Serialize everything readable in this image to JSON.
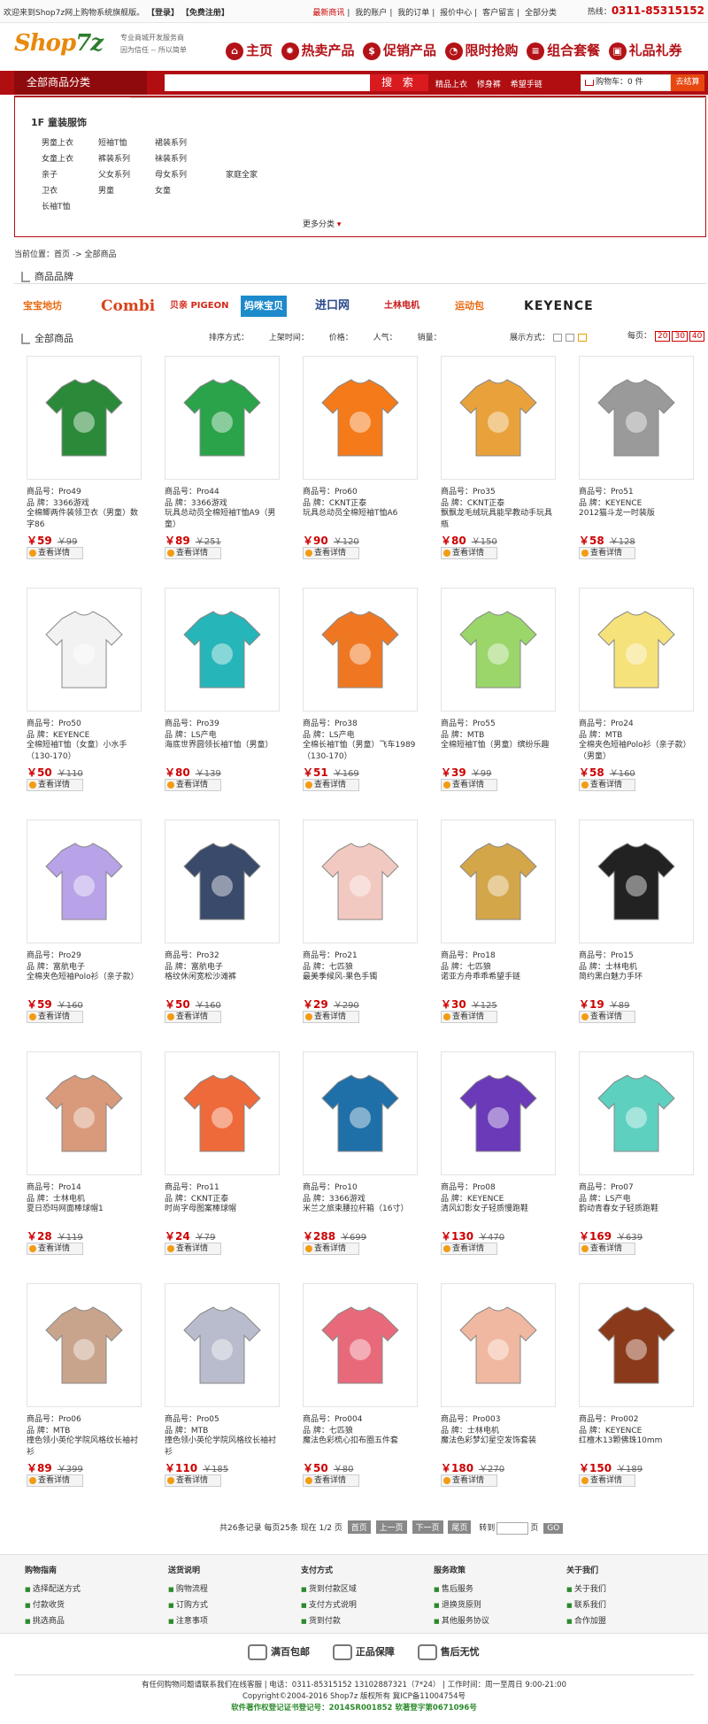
{
  "topbar": {
    "welcome_prefix": "欢迎来到Shop7z网上购物系统旗舰版。",
    "login": "【登录】",
    "register": "【免费注册】",
    "links": [
      "最新商讯",
      "我的账户",
      "我的订单",
      "报价中心",
      "客户留言",
      "全部分类"
    ],
    "hotline_label": "热线：",
    "hotline": "0311-85315152"
  },
  "header": {
    "logo": "Shop7z",
    "slogan_1": "专业商城开发服务商",
    "slogan_2": "因为信任 -- 所以简单",
    "nav": [
      "主页",
      "热卖产品",
      "促销产品",
      "限时抢购",
      "组合套餐",
      "礼品礼券"
    ]
  },
  "searchbar": {
    "all_categories": "全部商品分类",
    "search_button": "搜 索",
    "hot_words": [
      "精品上衣",
      "修身裤",
      "希望手链"
    ],
    "cart": "购物车：0 件",
    "checkout": "去结算"
  },
  "category": {
    "title": "1F  童装服饰",
    "rows": [
      [
        "男童上衣",
        "短袖T恤",
        "裙装系列",
        ""
      ],
      [
        "女童上衣",
        "裤装系列",
        "袜装系列",
        ""
      ],
      [
        "亲子",
        "父女系列",
        "母女系列",
        "家庭全家"
      ],
      [
        "卫衣",
        "男童",
        "女童",
        ""
      ],
      [
        "长袖T恤",
        "",
        "",
        ""
      ]
    ],
    "more": "更多分类"
  },
  "breadcrumb": "当前位置：首页 -> 全部商品",
  "brands_title": "商品品牌",
  "brands": [
    "宝宝地坊",
    "Combi",
    "贝亲 PIGEON",
    "妈咪宝贝",
    "进口网",
    "土林电机",
    "运动包",
    "KEYENCE"
  ],
  "all_products_title": "全部商品",
  "sort": {
    "label": "排序方式：",
    "options": [
      "上架时间：",
      "价格：",
      "人气：",
      "销量："
    ],
    "display_label": "展示方式：",
    "per_page_label": "每页：",
    "per_page": [
      "20",
      "30",
      "40"
    ]
  },
  "products": [
    {
      "code": "商品号：Pro49",
      "brand": "品  牌：3366游戏",
      "name": "全棉鲫两件装领卫衣（男童）数字86",
      "price": "￥59",
      "old": "￥99",
      "color": "#2a8a3a"
    },
    {
      "code": "商品号：Pro44",
      "brand": "品  牌：3366游戏",
      "name": "玩具总动员全棉短袖T恤A9（男童）",
      "price": "￥89",
      "old": "￥251",
      "color": "#2aa34a"
    },
    {
      "code": "商品号：Pro60",
      "brand": "品  牌：CKNT正泰",
      "name": "玩具总动员全棉短袖T恤A6",
      "price": "￥90",
      "old": "￥120",
      "color": "#f47a1a"
    },
    {
      "code": "商品号：Pro35",
      "brand": "品  牌：CKNT正泰",
      "name": "飘飘龙毛绒玩具能早教动手玩具瓶",
      "price": "￥80",
      "old": "￥150",
      "color": "#e9a23b"
    },
    {
      "code": "商品号：Pro51",
      "brand": "品  牌：KEYENCE",
      "name": "2012猫斗龙一时装版",
      "price": "￥58",
      "old": "￥128",
      "color": "#9a9a9a"
    },
    {
      "code": "商品号：Pro50",
      "brand": "品  牌：KEYENCE",
      "name": "全棉短袖T恤（女童）小水手（130-170）",
      "price": "￥50",
      "old": "￥110",
      "color": "#f2f2f2"
    },
    {
      "code": "商品号：Pro39",
      "brand": "品  牌：LS产电",
      "name": "海底世界圆领长袖T恤（男童）",
      "price": "￥80",
      "old": "￥139",
      "color": "#26b5b8"
    },
    {
      "code": "商品号：Pro38",
      "brand": "品  牌：LS产电",
      "name": "全棉长袖T恤（男童）飞车1989（130-170）",
      "price": "￥51",
      "old": "￥169",
      "color": "#f07722"
    },
    {
      "code": "商品号：Pro55",
      "brand": "品  牌：MTB",
      "name": "全棉短袖T恤（男童）缤纷乐趣",
      "price": "￥39",
      "old": "￥99",
      "color": "#9bd66a"
    },
    {
      "code": "商品号：Pro24",
      "brand": "品  牌：MTB",
      "name": "全棉夹色短袖Polo衫（亲子款）（男童）",
      "price": "￥58",
      "old": "￥160",
      "color": "#f5e27a"
    },
    {
      "code": "商品号：Pro29",
      "brand": "品  牌：富航电子",
      "name": "全棉夹色短袖Polo衫（亲子款）",
      "price": "￥59",
      "old": "￥160",
      "color": "#b8a2e8"
    },
    {
      "code": "商品号：Pro32",
      "brand": "品  牌：富航电子",
      "name": "格纹休闲宽松沙滩裤",
      "price": "￥50",
      "old": "￥160",
      "color": "#3a4a6a"
    },
    {
      "code": "商品号：Pro21",
      "brand": "品  牌：七匹狼",
      "name": "最美季候风-果色手镯",
      "price": "￥29",
      "old": "￥290",
      "color": "#f2c9c0"
    },
    {
      "code": "商品号：Pro18",
      "brand": "品  牌：七匹狼",
      "name": "诺亚方舟乖乖希望手链",
      "price": "￥30",
      "old": "￥125",
      "color": "#d4a64a"
    },
    {
      "code": "商品号：Pro15",
      "brand": "品  牌：士林电机",
      "name": "简约黑白魅力手环",
      "price": "￥19",
      "old": "￥89",
      "color": "#222222"
    },
    {
      "code": "商品号：Pro14",
      "brand": "品  牌：士林电机",
      "name": "夏日恐吗网面棒球帽1",
      "price": "￥28",
      "old": "￥119",
      "color": "#d89a7a"
    },
    {
      "code": "商品号：Pro11",
      "brand": "品  牌：CKNT正泰",
      "name": "时尚字母图案棒球帽",
      "price": "￥24",
      "old": "￥79",
      "color": "#ee6a3a"
    },
    {
      "code": "商品号：Pro10",
      "brand": "品  牌：3366游戏",
      "name": "米兰之旅束腰拉杆箱（16寸）",
      "price": "￥288",
      "old": "￥699",
      "color": "#1f6fa8"
    },
    {
      "code": "商品号：Pro08",
      "brand": "品  牌：KEYENCE",
      "name": "清风幻影女子轻质慢跑鞋",
      "price": "￥130",
      "old": "￥470",
      "color": "#6a3ab8"
    },
    {
      "code": "商品号：Pro07",
      "brand": "品  牌：LS产电",
      "name": "韵动青春女子轻质跑鞋",
      "price": "￥169",
      "old": "￥639",
      "color": "#5ed0c0"
    },
    {
      "code": "商品号：Pro06",
      "brand": "品  牌：MTB",
      "name": "撞色领小英伦学院风格纹长袖衬衫",
      "price": "￥89",
      "old": "￥399",
      "color": "#c9a48c"
    },
    {
      "code": "商品号：Pro05",
      "brand": "品  牌：MTB",
      "name": "撞色领小英伦学院风格纹长袖衬衫",
      "price": "￥110",
      "old": "￥185",
      "color": "#b8bccc"
    },
    {
      "code": "商品号：Pro004",
      "brand": "品  牌：七匹狼",
      "name": "魔法色彩梳心扣布圈五件套",
      "price": "￥50",
      "old": "￥80",
      "color": "#e86a7a"
    },
    {
      "code": "商品号：Pro003",
      "brand": "品  牌：士林电机",
      "name": "魔法色彩梦幻星空发饰套装",
      "price": "￥180",
      "old": "￥270",
      "color": "#f0b8a0"
    },
    {
      "code": "商品号：Pro002",
      "brand": "品  牌：KEYENCE",
      "name": "红檀木13颗佛珠10mm",
      "price": "￥150",
      "old": "￥189",
      "color": "#8a3a1a"
    }
  ],
  "detail_button": "查看详情",
  "pager": {
    "summary": "共26条记录  每页25条  现在 1/2 页",
    "buttons": [
      "首页",
      "上一页",
      "下一页",
      "尾页"
    ],
    "goto": "转到",
    "page_unit": "页",
    "go": "GO"
  },
  "footer": {
    "cols": [
      {
        "title": "购物指南",
        "items": [
          "选择配送方式",
          "付款收货",
          "挑选商品"
        ]
      },
      {
        "title": "送货说明",
        "items": [
          "购物流程",
          "订购方式",
          "注意事项"
        ]
      },
      {
        "title": "支付方式",
        "items": [
          "货到付款区域",
          "支付方式说明",
          "货到付款"
        ]
      },
      {
        "title": "服务政策",
        "items": [
          "售后服务",
          "退换货原则",
          "其他服务协议"
        ]
      },
      {
        "title": "关于我们",
        "items": [
          "关于我们",
          "联系我们",
          "合作加盟"
        ]
      }
    ],
    "badges": [
      "满百包邮",
      "正品保障",
      "售后无忧"
    ],
    "copy_1": "有任何购物问题请联系我们在线客服 | 电话：0311-85315152 13102887321（7*24） | 工作时间：周一至周日 9:00-21:00",
    "copy_2": "Copyright©2004-2016 Shop7z 版权所有   冀ICP备11004754号",
    "copy_3": "软件著作权登记证书登记号：2014SR001852  软著登字第0671096号"
  }
}
